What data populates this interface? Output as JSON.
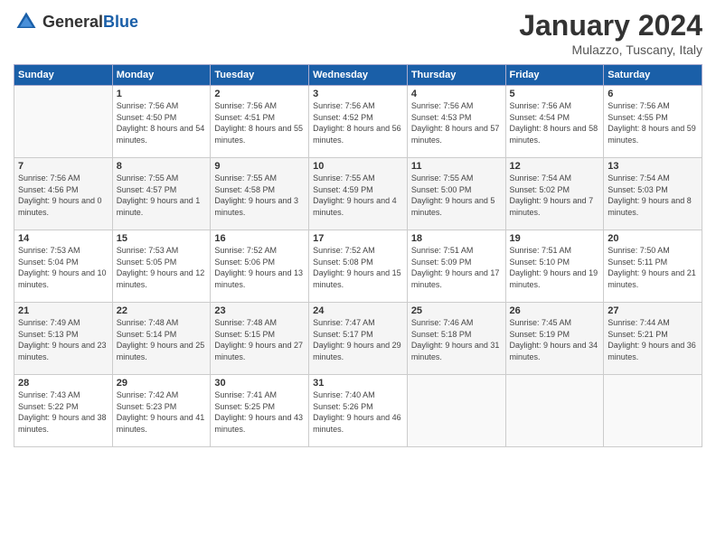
{
  "header": {
    "logo_general": "General",
    "logo_blue": "Blue",
    "month_title": "January 2024",
    "subtitle": "Mulazzo, Tuscany, Italy"
  },
  "columns": [
    "Sunday",
    "Monday",
    "Tuesday",
    "Wednesday",
    "Thursday",
    "Friday",
    "Saturday"
  ],
  "weeks": [
    [
      {
        "day": "",
        "sunrise": "",
        "sunset": "",
        "daylight": ""
      },
      {
        "day": "1",
        "sunrise": "Sunrise: 7:56 AM",
        "sunset": "Sunset: 4:50 PM",
        "daylight": "Daylight: 8 hours and 54 minutes."
      },
      {
        "day": "2",
        "sunrise": "Sunrise: 7:56 AM",
        "sunset": "Sunset: 4:51 PM",
        "daylight": "Daylight: 8 hours and 55 minutes."
      },
      {
        "day": "3",
        "sunrise": "Sunrise: 7:56 AM",
        "sunset": "Sunset: 4:52 PM",
        "daylight": "Daylight: 8 hours and 56 minutes."
      },
      {
        "day": "4",
        "sunrise": "Sunrise: 7:56 AM",
        "sunset": "Sunset: 4:53 PM",
        "daylight": "Daylight: 8 hours and 57 minutes."
      },
      {
        "day": "5",
        "sunrise": "Sunrise: 7:56 AM",
        "sunset": "Sunset: 4:54 PM",
        "daylight": "Daylight: 8 hours and 58 minutes."
      },
      {
        "day": "6",
        "sunrise": "Sunrise: 7:56 AM",
        "sunset": "Sunset: 4:55 PM",
        "daylight": "Daylight: 8 hours and 59 minutes."
      }
    ],
    [
      {
        "day": "7",
        "sunrise": "Sunrise: 7:56 AM",
        "sunset": "Sunset: 4:56 PM",
        "daylight": "Daylight: 9 hours and 0 minutes."
      },
      {
        "day": "8",
        "sunrise": "Sunrise: 7:55 AM",
        "sunset": "Sunset: 4:57 PM",
        "daylight": "Daylight: 9 hours and 1 minute."
      },
      {
        "day": "9",
        "sunrise": "Sunrise: 7:55 AM",
        "sunset": "Sunset: 4:58 PM",
        "daylight": "Daylight: 9 hours and 3 minutes."
      },
      {
        "day": "10",
        "sunrise": "Sunrise: 7:55 AM",
        "sunset": "Sunset: 4:59 PM",
        "daylight": "Daylight: 9 hours and 4 minutes."
      },
      {
        "day": "11",
        "sunrise": "Sunrise: 7:55 AM",
        "sunset": "Sunset: 5:00 PM",
        "daylight": "Daylight: 9 hours and 5 minutes."
      },
      {
        "day": "12",
        "sunrise": "Sunrise: 7:54 AM",
        "sunset": "Sunset: 5:02 PM",
        "daylight": "Daylight: 9 hours and 7 minutes."
      },
      {
        "day": "13",
        "sunrise": "Sunrise: 7:54 AM",
        "sunset": "Sunset: 5:03 PM",
        "daylight": "Daylight: 9 hours and 8 minutes."
      }
    ],
    [
      {
        "day": "14",
        "sunrise": "Sunrise: 7:53 AM",
        "sunset": "Sunset: 5:04 PM",
        "daylight": "Daylight: 9 hours and 10 minutes."
      },
      {
        "day": "15",
        "sunrise": "Sunrise: 7:53 AM",
        "sunset": "Sunset: 5:05 PM",
        "daylight": "Daylight: 9 hours and 12 minutes."
      },
      {
        "day": "16",
        "sunrise": "Sunrise: 7:52 AM",
        "sunset": "Sunset: 5:06 PM",
        "daylight": "Daylight: 9 hours and 13 minutes."
      },
      {
        "day": "17",
        "sunrise": "Sunrise: 7:52 AM",
        "sunset": "Sunset: 5:08 PM",
        "daylight": "Daylight: 9 hours and 15 minutes."
      },
      {
        "day": "18",
        "sunrise": "Sunrise: 7:51 AM",
        "sunset": "Sunset: 5:09 PM",
        "daylight": "Daylight: 9 hours and 17 minutes."
      },
      {
        "day": "19",
        "sunrise": "Sunrise: 7:51 AM",
        "sunset": "Sunset: 5:10 PM",
        "daylight": "Daylight: 9 hours and 19 minutes."
      },
      {
        "day": "20",
        "sunrise": "Sunrise: 7:50 AM",
        "sunset": "Sunset: 5:11 PM",
        "daylight": "Daylight: 9 hours and 21 minutes."
      }
    ],
    [
      {
        "day": "21",
        "sunrise": "Sunrise: 7:49 AM",
        "sunset": "Sunset: 5:13 PM",
        "daylight": "Daylight: 9 hours and 23 minutes."
      },
      {
        "day": "22",
        "sunrise": "Sunrise: 7:48 AM",
        "sunset": "Sunset: 5:14 PM",
        "daylight": "Daylight: 9 hours and 25 minutes."
      },
      {
        "day": "23",
        "sunrise": "Sunrise: 7:48 AM",
        "sunset": "Sunset: 5:15 PM",
        "daylight": "Daylight: 9 hours and 27 minutes."
      },
      {
        "day": "24",
        "sunrise": "Sunrise: 7:47 AM",
        "sunset": "Sunset: 5:17 PM",
        "daylight": "Daylight: 9 hours and 29 minutes."
      },
      {
        "day": "25",
        "sunrise": "Sunrise: 7:46 AM",
        "sunset": "Sunset: 5:18 PM",
        "daylight": "Daylight: 9 hours and 31 minutes."
      },
      {
        "day": "26",
        "sunrise": "Sunrise: 7:45 AM",
        "sunset": "Sunset: 5:19 PM",
        "daylight": "Daylight: 9 hours and 34 minutes."
      },
      {
        "day": "27",
        "sunrise": "Sunrise: 7:44 AM",
        "sunset": "Sunset: 5:21 PM",
        "daylight": "Daylight: 9 hours and 36 minutes."
      }
    ],
    [
      {
        "day": "28",
        "sunrise": "Sunrise: 7:43 AM",
        "sunset": "Sunset: 5:22 PM",
        "daylight": "Daylight: 9 hours and 38 minutes."
      },
      {
        "day": "29",
        "sunrise": "Sunrise: 7:42 AM",
        "sunset": "Sunset: 5:23 PM",
        "daylight": "Daylight: 9 hours and 41 minutes."
      },
      {
        "day": "30",
        "sunrise": "Sunrise: 7:41 AM",
        "sunset": "Sunset: 5:25 PM",
        "daylight": "Daylight: 9 hours and 43 minutes."
      },
      {
        "day": "31",
        "sunrise": "Sunrise: 7:40 AM",
        "sunset": "Sunset: 5:26 PM",
        "daylight": "Daylight: 9 hours and 46 minutes."
      },
      {
        "day": "",
        "sunrise": "",
        "sunset": "",
        "daylight": ""
      },
      {
        "day": "",
        "sunrise": "",
        "sunset": "",
        "daylight": ""
      },
      {
        "day": "",
        "sunrise": "",
        "sunset": "",
        "daylight": ""
      }
    ]
  ]
}
